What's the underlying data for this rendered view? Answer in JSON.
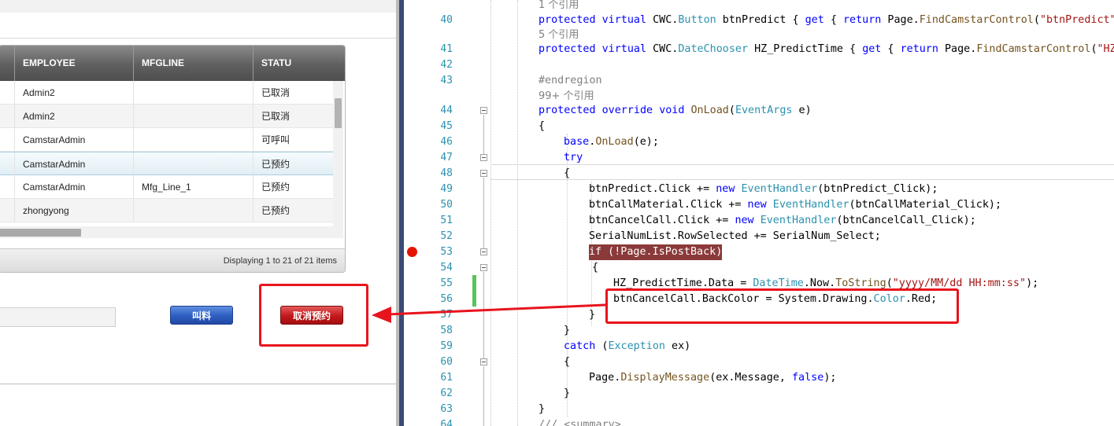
{
  "grid": {
    "columns": [
      "EMPLOYEE",
      "MFGLINE",
      "STATU"
    ],
    "rows": [
      {
        "employee": "Admin2",
        "mfgline": "",
        "status": "已取消"
      },
      {
        "employee": "Admin2",
        "mfgline": "",
        "status": "已取消"
      },
      {
        "employee": "CamstarAdmin",
        "mfgline": "",
        "status": "可呼叫"
      },
      {
        "employee": "CamstarAdmin",
        "mfgline": "",
        "status": "已预约"
      },
      {
        "employee": "CamstarAdmin",
        "mfgline": "Mfg_Line_1",
        "status": "已预约"
      },
      {
        "employee": "zhongyong",
        "mfgline": "",
        "status": "已预约"
      }
    ],
    "footer": "Displaying 1 to 21 of 21 items"
  },
  "buttons": {
    "call": "叫料",
    "cancel": "取消预约"
  },
  "editor": {
    "lines": [
      {
        "num": "",
        "ref": "1 个引用"
      },
      {
        "num": "40"
      },
      {
        "num": "",
        "ref": "5 个引用"
      },
      {
        "num": "41"
      },
      {
        "num": "42"
      },
      {
        "num": "43"
      },
      {
        "num": "",
        "ref": "99+ 个引用"
      },
      {
        "num": "44"
      },
      {
        "num": "45"
      },
      {
        "num": "46"
      },
      {
        "num": "47"
      },
      {
        "num": "48"
      },
      {
        "num": "49"
      },
      {
        "num": "50"
      },
      {
        "num": "51"
      },
      {
        "num": "52"
      },
      {
        "num": "53"
      },
      {
        "num": "54"
      },
      {
        "num": "55"
      },
      {
        "num": "56"
      },
      {
        "num": "57"
      },
      {
        "num": "58"
      },
      {
        "num": "59"
      },
      {
        "num": "60"
      },
      {
        "num": "61"
      },
      {
        "num": "62"
      },
      {
        "num": "63"
      },
      {
        "num": "64"
      }
    ],
    "code": {
      "l40": "protected virtual CWC.Button btnPredict { get { return Page.FindCamstarControl(\"btnPredict\");",
      "l41": "protected virtual CWC.DateChooser HZ_PredictTime { get { return Page.FindCamstarControl(\"HZ_",
      "l43": "#endregion",
      "l44": "protected override void OnLoad(EventArgs e)",
      "l45": "{",
      "l46": "base.OnLoad(e);",
      "l47": "try",
      "l48": "{",
      "l49": "btnPredict.Click += new EventHandler(btnPredict_Click);",
      "l50": "btnCallMaterial.Click += new EventHandler(btnCallMaterial_Click);",
      "l51": "btnCancelCall.Click += new EventHandler(btnCancelCall_Click);",
      "l52": "SerialNumList.RowSelected += SerialNum_Select;",
      "l53": "if (!Page.IsPostBack)",
      "l54": "{",
      "l55": "HZ_PredictTime.Data = DateTime.Now.ToString(\"yyyy/MM/dd HH:mm:ss\");",
      "l56": "btnCancelCall.BackColor = System.Drawing.Color.Red;",
      "l57": "}",
      "l58": "}",
      "l59": "catch (Exception ex)",
      "l60": "{",
      "l61": "Page.DisplayMessage(ex.Message, false);",
      "l62": "}",
      "l63": "}",
      "l64": "/// <summary>"
    }
  },
  "colors": {
    "annotation": "#e8141d",
    "cancel_button": "#c2181b",
    "call_button": "#2e5dc1",
    "keyword": "#0000ff",
    "type": "#2b91af"
  }
}
